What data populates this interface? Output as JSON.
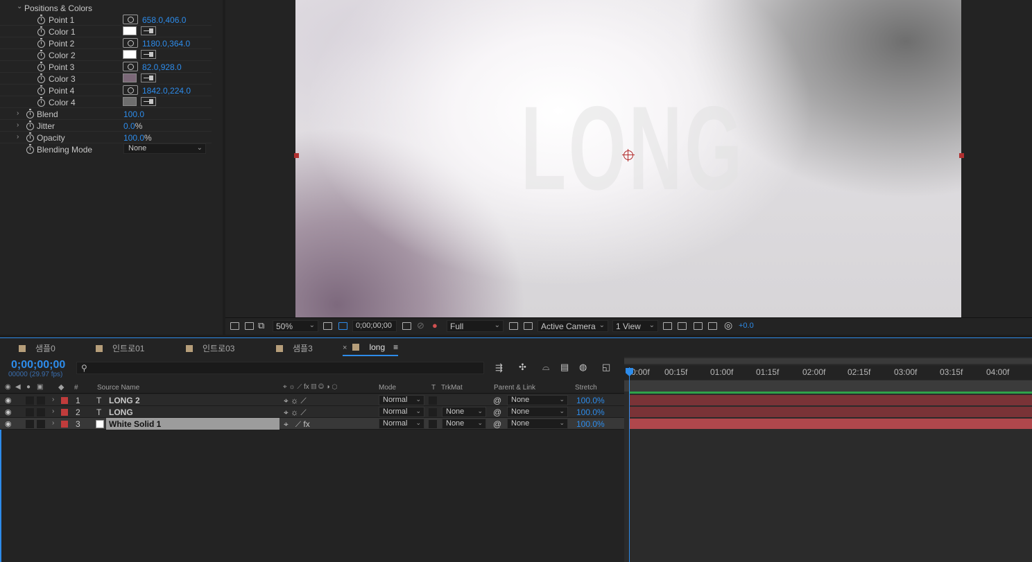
{
  "effect_controls": {
    "group": "Positions & Colors",
    "params": [
      {
        "name": "Point 1",
        "value": "658.0,406.0",
        "kind": "point"
      },
      {
        "name": "Color 1",
        "color": "#ffffff",
        "kind": "color"
      },
      {
        "name": "Point 2",
        "value": "1180.0,364.0",
        "kind": "point"
      },
      {
        "name": "Color 2",
        "color": "#ffffff",
        "kind": "color"
      },
      {
        "name": "Point 3",
        "value": "82.0,928.0",
        "kind": "point"
      },
      {
        "name": "Color 3",
        "color": "#7b6878",
        "kind": "color"
      },
      {
        "name": "Point 4",
        "value": "1842.0,224.0",
        "kind": "point"
      },
      {
        "name": "Color 4",
        "color": "#6e6e6e",
        "kind": "color"
      }
    ],
    "blend": {
      "name": "Blend",
      "value": "100.0"
    },
    "jitter": {
      "name": "Jitter",
      "value": "0.0",
      "unit": "%"
    },
    "opacity": {
      "name": "Opacity",
      "value": "100.0",
      "unit": "%"
    },
    "blending_mode": {
      "name": "Blending Mode",
      "value": "None"
    }
  },
  "viewer": {
    "comp_text": "LONG",
    "zoom": "50%",
    "timecode": "0;00;00;00",
    "resolution": "Full",
    "camera": "Active Camera",
    "views": "1 View",
    "exposure": "+0.0"
  },
  "tabs": [
    {
      "label": "샘플0"
    },
    {
      "label": "인트로01"
    },
    {
      "label": "인트로03"
    },
    {
      "label": "샘플3"
    },
    {
      "label": "long",
      "active": true
    }
  ],
  "timeline": {
    "timecode": "0;00;00;00",
    "frames": "00000 (29.97 fps)",
    "columns": {
      "num": "#",
      "source_name": "Source Name",
      "mode": "Mode",
      "t": "T",
      "trkmat": "TrkMat",
      "parent": "Parent & Link",
      "stretch": "Stretch"
    },
    "layers": [
      {
        "num": "1",
        "type": "T",
        "name": "LONG 2",
        "mode": "Normal",
        "trkmat": "",
        "parent": "None",
        "stretch": "100.0%"
      },
      {
        "num": "2",
        "type": "T",
        "name": "LONG",
        "mode": "Normal",
        "trkmat": "None",
        "parent": "None",
        "stretch": "100.0%"
      },
      {
        "num": "3",
        "type": "solid",
        "name": "White Solid 1",
        "mode": "Normal",
        "trkmat": "None",
        "parent": "None",
        "stretch": "100.0%"
      }
    ],
    "ruler": [
      "0:00f",
      "00:15f",
      "01:00f",
      "01:15f",
      "02:00f",
      "02:15f",
      "03:00f",
      "03:15f",
      "04:00f"
    ]
  }
}
